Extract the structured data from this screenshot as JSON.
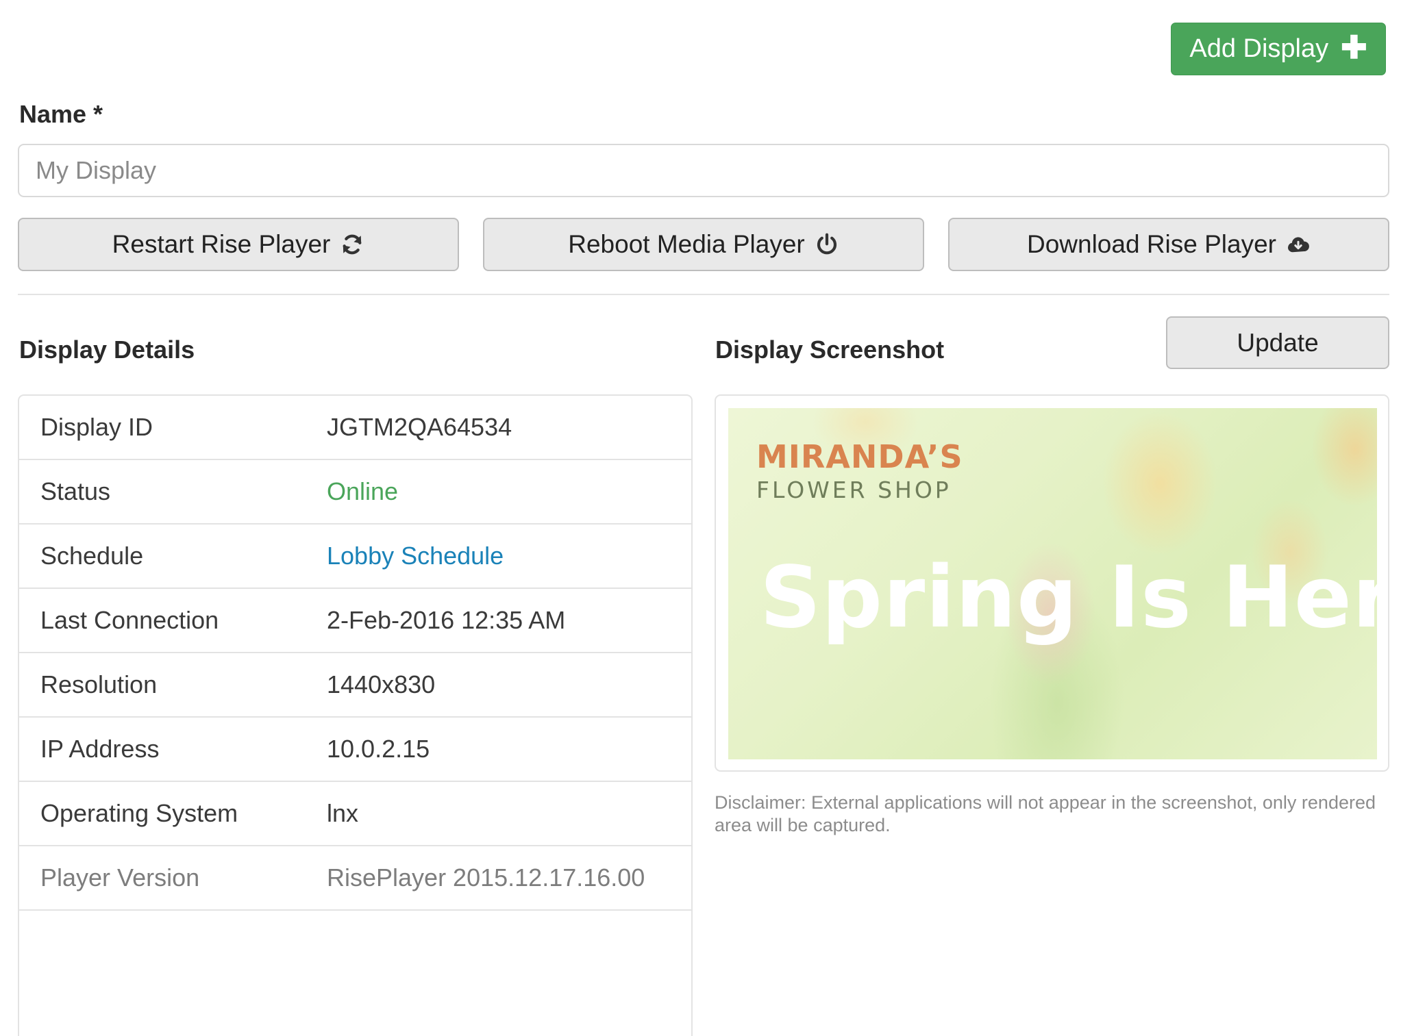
{
  "header": {
    "add_display_label": "Add Display"
  },
  "form": {
    "name_label": "Name *",
    "name_placeholder": "My Display",
    "name_value": ""
  },
  "actions": {
    "restart_label": "Restart Rise Player",
    "reboot_label": "Reboot Media Player",
    "download_label": "Download Rise Player"
  },
  "details": {
    "title": "Display Details",
    "rows": [
      {
        "label": "Display ID",
        "value": "JGTM2QA64534"
      },
      {
        "label": "Status",
        "value": "Online"
      },
      {
        "label": "Schedule",
        "value": "Lobby Schedule"
      },
      {
        "label": "Last Connection",
        "value": "2-Feb-2016 12:35 AM"
      },
      {
        "label": "Resolution",
        "value": "1440x830"
      },
      {
        "label": "IP Address",
        "value": "10.0.2.15"
      },
      {
        "label": "Operating System",
        "value": "lnx"
      },
      {
        "label": "Player Version",
        "value": "RisePlayer 2015.12.17.16.00"
      }
    ]
  },
  "screenshot": {
    "title": "Display Screenshot",
    "update_label": "Update",
    "brand_name": "MIRANDA’S",
    "brand_sub": "FLOWER SHOP",
    "headline": "Spring Is Here",
    "disclaimer": "Disclaimer: External applications will not appear in the screenshot, only rendered area will be captured."
  },
  "colors": {
    "success": "#4aa55a",
    "link": "#1a82b8",
    "button_bg": "#e9e9e9",
    "border": "#e3e3e3"
  },
  "icons": {
    "add": "plus-icon",
    "restart": "refresh-icon",
    "reboot": "power-icon",
    "download": "cloud-download-icon"
  }
}
